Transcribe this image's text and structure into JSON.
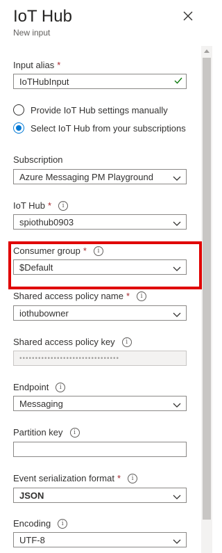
{
  "header": {
    "title": "IoT Hub",
    "subtitle": "New input"
  },
  "fields": {
    "input_alias": {
      "label": "Input alias",
      "required": "*",
      "value": "IoTHubInput"
    },
    "radio_manual": {
      "label": "Provide IoT Hub settings manually",
      "selected": false
    },
    "radio_subscription": {
      "label": "Select IoT Hub from your subscriptions",
      "selected": true
    },
    "subscription": {
      "label": "Subscription",
      "value": "Azure Messaging PM Playground"
    },
    "iot_hub": {
      "label": "IoT Hub",
      "required": "*",
      "value": "spiothub0903"
    },
    "consumer_group": {
      "label": "Consumer group",
      "required": "*",
      "value": "$Default"
    },
    "shared_policy_name": {
      "label": "Shared access policy name",
      "required": "*",
      "value": "iothubowner"
    },
    "shared_policy_key": {
      "label": "Shared access policy key",
      "value": "••••••••••••••••••••••••••••••••"
    },
    "endpoint": {
      "label": "Endpoint",
      "value": "Messaging"
    },
    "partition_key": {
      "label": "Partition key",
      "value": ""
    },
    "event_format": {
      "label": "Event serialization format",
      "required": "*",
      "value": "JSON"
    },
    "encoding": {
      "label": "Encoding",
      "value": "UTF-8"
    }
  },
  "colors": {
    "accent": "#0078d4",
    "highlight": "#e00000",
    "required": "#a4262c",
    "valid": "#107c10"
  }
}
